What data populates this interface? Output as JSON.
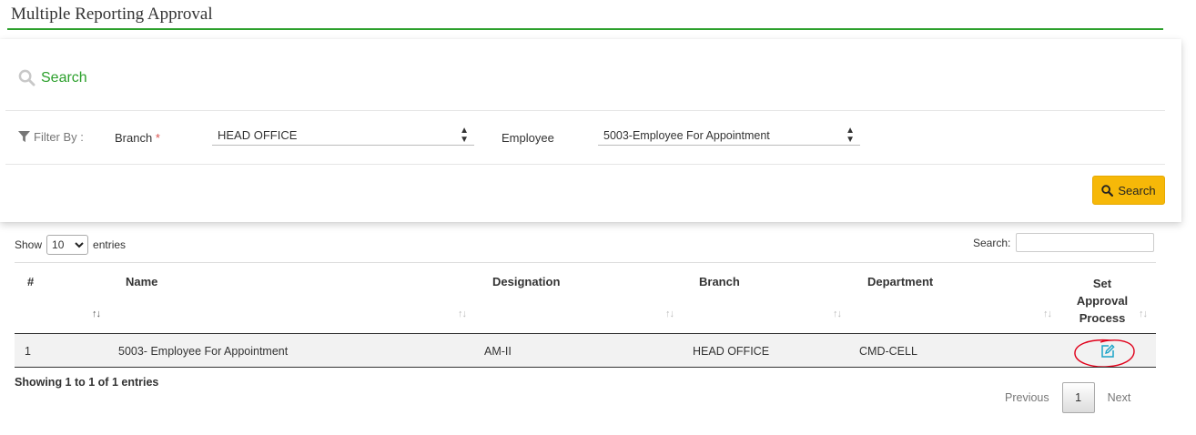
{
  "page": {
    "title": "Multiple Reporting Approval"
  },
  "search_panel": {
    "heading": "Search",
    "filter_by_label": "Filter By :",
    "branch_label": "Branch",
    "required_mark": "*",
    "branch_value": "HEAD OFFICE",
    "employee_label": "Employee",
    "employee_value": "5003-Employee For Appointment",
    "search_button": "Search"
  },
  "table_controls": {
    "show_label": "Show",
    "length_value": "10",
    "entries_label": "entries",
    "search_label": "Search:",
    "search_value": ""
  },
  "table": {
    "headers": {
      "num": "#",
      "name": "Name",
      "designation": "Designation",
      "branch": "Branch",
      "department": "Department",
      "set": "Set",
      "approval": "Approval",
      "process": "Process"
    },
    "rows": [
      {
        "num": "1",
        "name": "5003- Employee For Appointment",
        "designation": "AM-II",
        "branch": "HEAD OFFICE",
        "department": "CMD-CELL",
        "action_icon": "edit-icon"
      }
    ]
  },
  "footer": {
    "info": "Showing 1 to 1 of 1 entries",
    "previous": "Previous",
    "current_page": "1",
    "next": "Next"
  },
  "colors": {
    "accent_green": "#2ca02c",
    "search_button": "#f6b808",
    "edit_icon": "#1aa3c8",
    "annotation_circle": "#e0001a"
  }
}
